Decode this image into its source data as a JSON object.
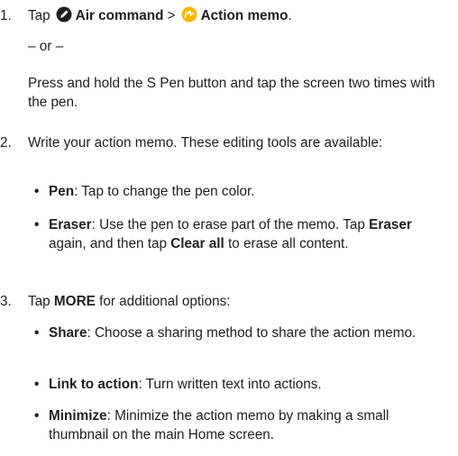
{
  "step1": {
    "number": "1.",
    "tap_word": "Tap",
    "air_command_label": "Air command",
    "separator": ">",
    "action_memo_label": "Action memo",
    "period": ".",
    "or_text": "– or –",
    "alt_text": "Press and hold the S Pen button and tap the screen two times with the pen.",
    "icons": {
      "air_command": "air-command-icon",
      "action_memo": "action-memo-icon"
    },
    "colors": {
      "air_command_icon": "#1f1f1f",
      "action_memo_icon": "#f5b800"
    }
  },
  "step2": {
    "number": "2.",
    "text": "Write your action memo. These editing tools are available:",
    "bullets": [
      {
        "term": "Pen",
        "desc": ": Tap to change the pen color."
      },
      {
        "term": "Eraser",
        "desc": ": Use the pen to erase part of the memo. Tap ",
        "term2": "Eraser",
        "desc2": " again, and then tap ",
        "term3": "Clear all",
        "desc3": " to erase all content."
      }
    ]
  },
  "step3": {
    "number": "3.",
    "tap_word": "Tap",
    "more_label": "MORE",
    "rest": " for additional options:",
    "bullets": [
      {
        "term": "Share",
        "desc": ": Choose a sharing method to share the action memo."
      },
      {
        "term": "Link to action",
        "desc": ": Turn written text into actions."
      },
      {
        "term": "Minimize",
        "desc": ": Minimize the action memo by making a small thumbnail on the main Home screen."
      }
    ]
  },
  "bullet_char": "•"
}
